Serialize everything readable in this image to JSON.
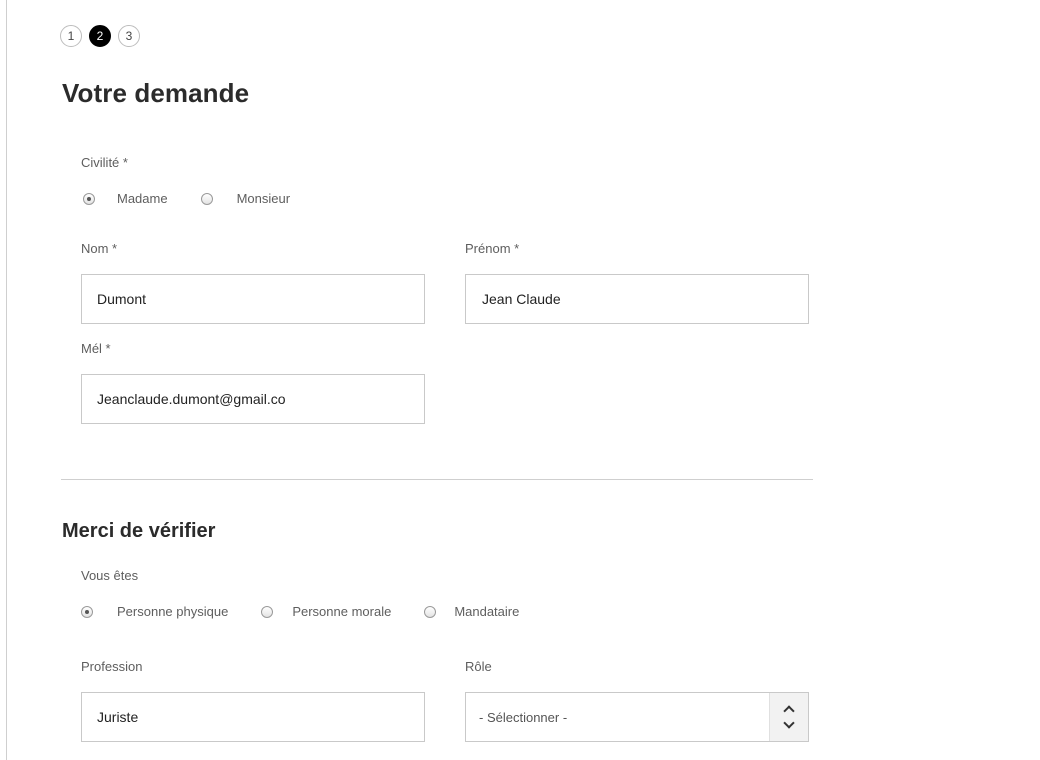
{
  "stepper": {
    "steps": [
      "1",
      "2",
      "3"
    ],
    "active_index": 1
  },
  "section1": {
    "title": "Votre demande",
    "civilite": {
      "label": "Civilité *",
      "options": [
        "Madame",
        "Monsieur"
      ],
      "selected": "Madame"
    },
    "nom": {
      "label": "Nom *",
      "value": "Dumont"
    },
    "prenom": {
      "label": "Prénom *",
      "value": "Jean Claude"
    },
    "mel": {
      "label": "Mél *",
      "value": "Jeanclaude.dumont@gmail.co"
    }
  },
  "section2": {
    "title": "Merci de vérifier",
    "vous_etes": {
      "label": "Vous êtes",
      "options": [
        "Personne physique",
        "Personne morale",
        "Mandataire"
      ],
      "selected": "Personne physique"
    },
    "profession": {
      "label": "Profession",
      "value": "Juriste"
    },
    "role": {
      "label": "Rôle",
      "value": "- Sélectionner -"
    }
  }
}
